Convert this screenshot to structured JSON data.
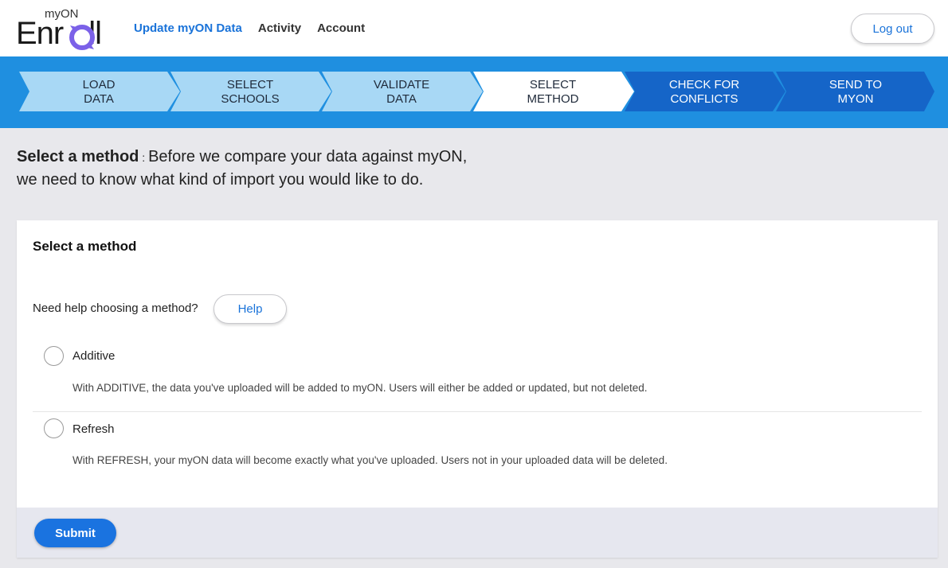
{
  "header": {
    "logo_small": "myON",
    "logo_big": "Enr",
    "logo_end": "ll",
    "nav": [
      "Update myON Data",
      "Activity",
      "Account"
    ],
    "logout_label": "Log out"
  },
  "stepper": {
    "steps": [
      {
        "line1": "LOAD",
        "line2": "DATA",
        "state": "done"
      },
      {
        "line1": "SELECT",
        "line2": "SCHOOLS",
        "state": "done"
      },
      {
        "line1": "VALIDATE",
        "line2": "DATA",
        "state": "done"
      },
      {
        "line1": "SELECT",
        "line2": "METHOD",
        "state": "current"
      },
      {
        "line1": "CHECK FOR",
        "line2": "CONFLICTS",
        "state": "upcoming"
      },
      {
        "line1": "SEND TO",
        "line2": "MYON",
        "state": "upcoming"
      }
    ],
    "colors": {
      "done": "#a8d8f5",
      "current": "#ffffff",
      "upcoming": "#1565c8",
      "background": "#1f8fe0"
    }
  },
  "intro": {
    "heading": "Select a method",
    "separator": " : ",
    "line1": "Before we compare your data against myON,",
    "line2": "we need to know what kind of import you would like to do."
  },
  "card": {
    "title": "Select a method",
    "help_prompt": "Need help choosing a method?",
    "help_label": "Help",
    "options": [
      {
        "label": "Additive",
        "description": "With ADDITIVE, the data you've uploaded will be added to myON. Users will either be added or updated, but not deleted."
      },
      {
        "label": "Refresh",
        "description": "With REFRESH, your myON data will become exactly what you've uploaded. Users not in your uploaded data will be deleted."
      }
    ],
    "submit_label": "Submit"
  }
}
